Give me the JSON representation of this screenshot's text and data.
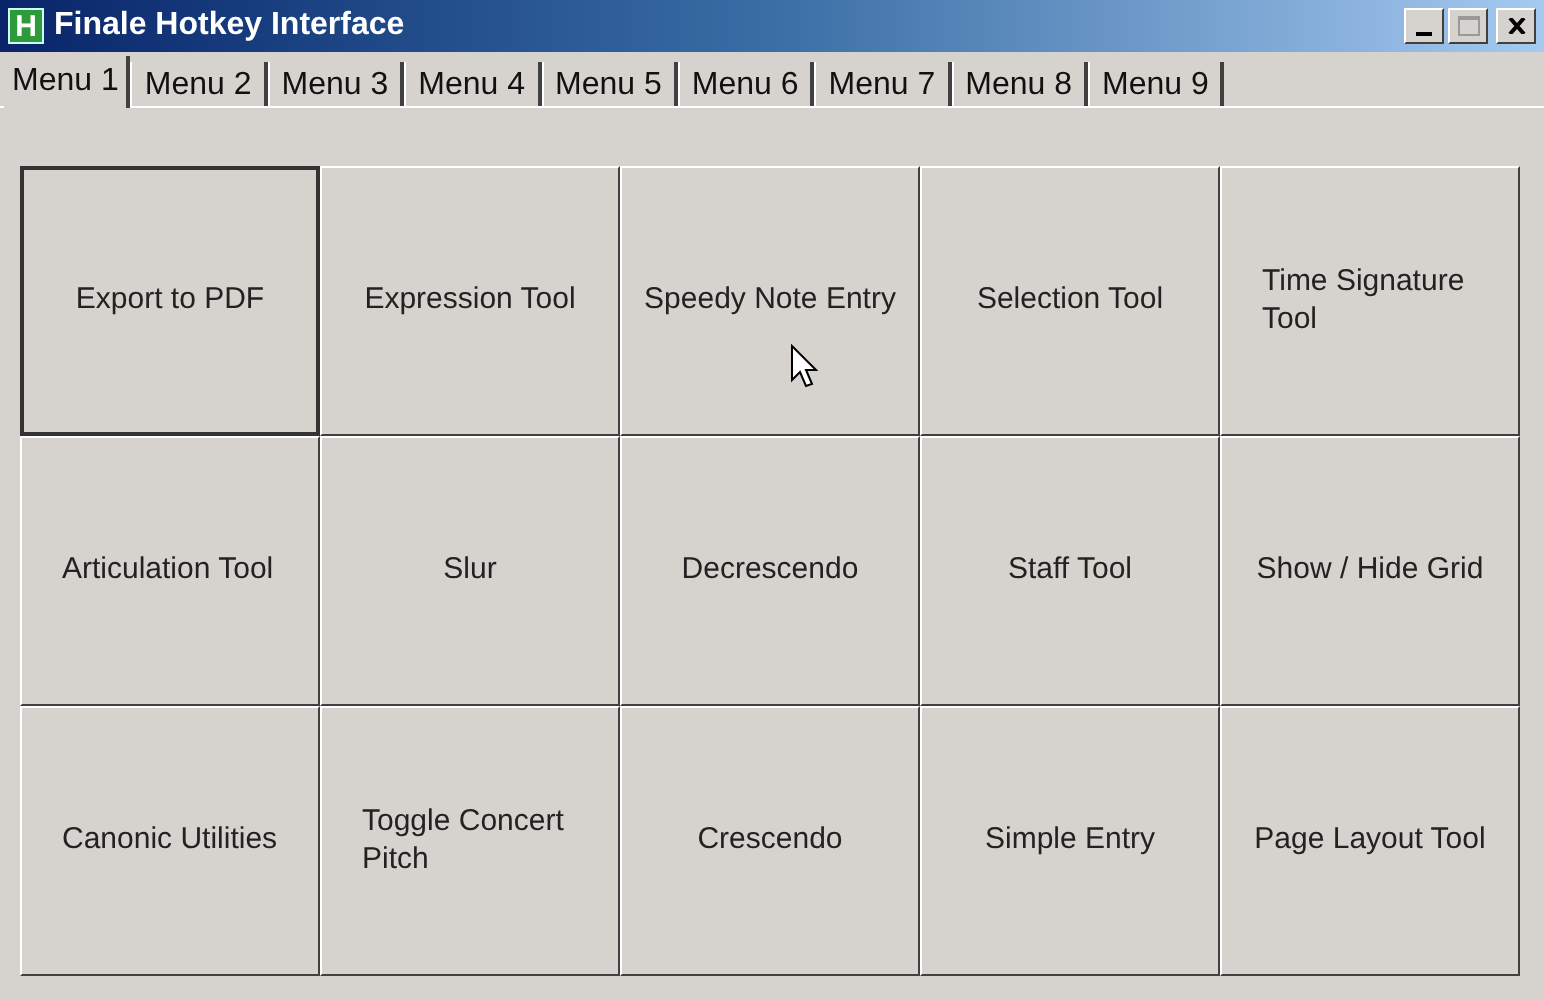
{
  "window": {
    "title": "Finale Hotkey Interface",
    "app_icon_letter": "H"
  },
  "tabs": [
    {
      "label": "Menu 1",
      "selected": true
    },
    {
      "label": "Menu 2",
      "selected": false
    },
    {
      "label": "Menu 3",
      "selected": false
    },
    {
      "label": "Menu 4",
      "selected": false
    },
    {
      "label": "Menu 5",
      "selected": false
    },
    {
      "label": "Menu 6",
      "selected": false
    },
    {
      "label": "Menu 7",
      "selected": false
    },
    {
      "label": "Menu 8",
      "selected": false
    },
    {
      "label": "Menu 9",
      "selected": false
    }
  ],
  "buttons": [
    {
      "label": "Export to PDF",
      "focused": true
    },
    {
      "label": "Expression Tool",
      "focused": false
    },
    {
      "label": "Speedy Note Entry",
      "focused": false,
      "hovered": true
    },
    {
      "label": "Selection Tool",
      "focused": false
    },
    {
      "label": "Time Signature Tool",
      "focused": false
    },
    {
      "label": "Articulation Tool",
      "focused": false
    },
    {
      "label": "Slur",
      "focused": false
    },
    {
      "label": "Decrescendo",
      "focused": false
    },
    {
      "label": "Staff Tool",
      "focused": false
    },
    {
      "label": "Show / Hide Grid",
      "focused": false
    },
    {
      "label": "Canonic Utilities",
      "focused": false
    },
    {
      "label": "Toggle Concert Pitch",
      "focused": false
    },
    {
      "label": "Crescendo",
      "focused": false
    },
    {
      "label": "Simple Entry",
      "focused": false
    },
    {
      "label": "Page Layout Tool",
      "focused": false
    }
  ]
}
